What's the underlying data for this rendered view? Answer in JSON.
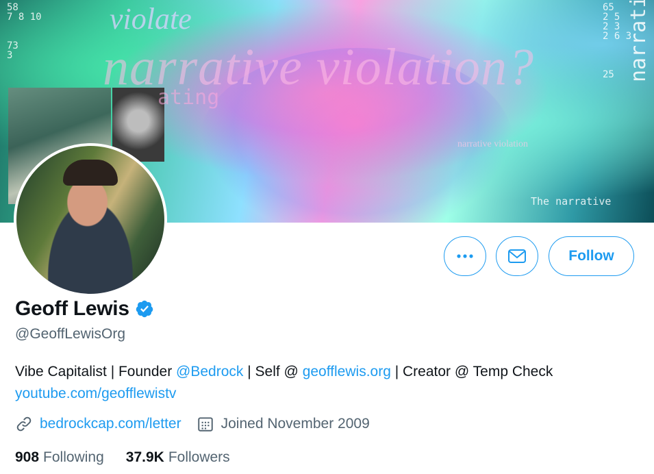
{
  "profile": {
    "name": "Geoff Lewis",
    "handle": "@GeoffLewisOrg",
    "verified": true,
    "bio": {
      "part1": "Vibe Capitalist | Founder ",
      "mention": "@Bedrock",
      "part2": " | Self @ ",
      "site_link": "geofflewis.org",
      "part3": " | Creator @ Temp Check",
      "youtube_link": "youtube.com/geofflewistv"
    },
    "website": "bedrockcap.com/letter",
    "joined": "Joined November 2009",
    "stats": {
      "following_count": "908",
      "following_label": "Following",
      "followers_count": "37.9K",
      "followers_label": "Followers"
    }
  },
  "banner": {
    "text_narrative": "narrative violation?",
    "text_violate": "violate",
    "text_ating": "ating",
    "text_small": "narrative violation",
    "text_the_narrative": "The narrative",
    "text_side": "narrative has",
    "numbers_left": "58\n7 8 10\n\n\n73\n3",
    "numbers_right": "65\n2 5\n2 3\n2 6 3\n\n\n\n25"
  },
  "actions": {
    "follow_label": "Follow",
    "more_icon": "more-icon",
    "message_icon": "message-icon"
  },
  "colors": {
    "accent": "#1d9bf0",
    "text_primary": "#0f1419",
    "text_secondary": "#536471"
  }
}
